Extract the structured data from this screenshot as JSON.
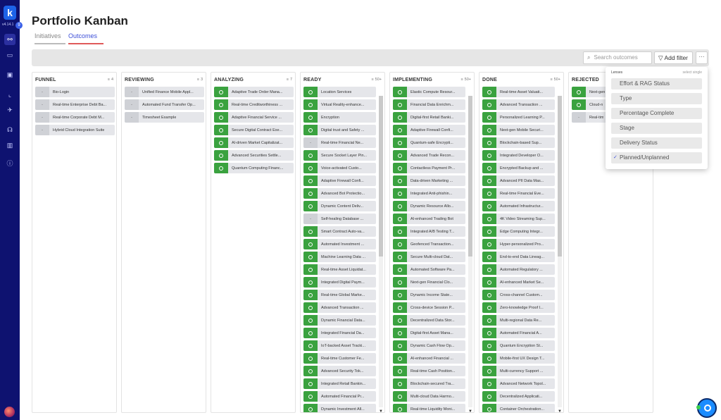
{
  "app": {
    "version": "v4.14.1",
    "notifications": "9",
    "title": "Portfolio Kanban"
  },
  "tabs": [
    {
      "label": "Initiatives",
      "active": false
    },
    {
      "label": "Outcomes",
      "active": true
    }
  ],
  "toolbar": {
    "search_placeholder": "Search outcomes",
    "add_filter_label": "Add filter",
    "more_label": "···"
  },
  "columns": [
    {
      "name": "FUNNEL",
      "count": "4",
      "cards": [
        {
          "status": "none",
          "title": "Bio-Login"
        },
        {
          "status": "none",
          "title": "Real-time Enterprise Debt Ba..."
        },
        {
          "status": "none",
          "title": "Real-time Corporate Debt M..."
        },
        {
          "status": "none",
          "title": "Hybrid Cloud Integration Suite"
        }
      ]
    },
    {
      "name": "REVIEWING",
      "count": "3",
      "cards": [
        {
          "status": "none",
          "title": "Unified Finance Mobile Appl..."
        },
        {
          "status": "none",
          "title": "Automated Fund Transfer Op..."
        },
        {
          "status": "none",
          "title": "Timesheet Example"
        }
      ]
    },
    {
      "name": "ANALYZING",
      "count": "7",
      "cards": [
        {
          "status": "green",
          "title": "Adaptive Trade Order Mana..."
        },
        {
          "status": "green",
          "title": "Real-time Creditworthiness ..."
        },
        {
          "status": "green",
          "title": "Adaptive Financial Service ..."
        },
        {
          "status": "green",
          "title": "Secure Digital Contract Exe..."
        },
        {
          "status": "green",
          "title": "AI-driven Market Capitalizat..."
        },
        {
          "status": "green",
          "title": "Advanced Securities Settle..."
        },
        {
          "status": "green",
          "title": "Quantum Computing Financ..."
        }
      ]
    },
    {
      "name": "READY",
      "count": "50+",
      "scroll": true,
      "cards": [
        {
          "status": "green",
          "title": "Location Services"
        },
        {
          "status": "green",
          "title": "Virtual Reality-enhance..."
        },
        {
          "status": "green",
          "title": "Encryption"
        },
        {
          "status": "green",
          "title": "Digital trust and Safety ..."
        },
        {
          "status": "none",
          "title": "Real-time Financial Ne..."
        },
        {
          "status": "green",
          "title": "Secure Socket Layer Pin..."
        },
        {
          "status": "green",
          "title": "Voice-activated Custo..."
        },
        {
          "status": "green",
          "title": "Adaptive Firewall Confi..."
        },
        {
          "status": "green",
          "title": "Advanced Bot Protectio..."
        },
        {
          "status": "green",
          "title": "Dynamic Content Deliv..."
        },
        {
          "status": "none",
          "title": "Self-healing Database ..."
        },
        {
          "status": "green",
          "title": "Smart Contract Auto-va..."
        },
        {
          "status": "green",
          "title": "Automated Investment ..."
        },
        {
          "status": "green",
          "title": "Machine Learning Data ..."
        },
        {
          "status": "green",
          "title": "Real-time Asset Liquidat..."
        },
        {
          "status": "green",
          "title": "Integrated Digital Paym..."
        },
        {
          "status": "green",
          "title": "Real-time Global Marke..."
        },
        {
          "status": "green",
          "title": "Advanced Transaction ..."
        },
        {
          "status": "green",
          "title": "Dynamic Financial Data..."
        },
        {
          "status": "green",
          "title": "Integrated Financial Da..."
        },
        {
          "status": "green",
          "title": "IoT-backed Asset Tracki..."
        },
        {
          "status": "green",
          "title": "Real-time Customer Fe..."
        },
        {
          "status": "green",
          "title": "Advanced Security Tok..."
        },
        {
          "status": "green",
          "title": "Integrated Retail Bankin..."
        },
        {
          "status": "green",
          "title": "Automated Financial Pr..."
        },
        {
          "status": "green",
          "title": "Dynamic Investment All..."
        }
      ]
    },
    {
      "name": "IMPLEMENTING",
      "count": "50+",
      "scroll": true,
      "cards": [
        {
          "status": "green",
          "title": "Elastic Compute Resour..."
        },
        {
          "status": "green",
          "title": "Financial Data Enrichm..."
        },
        {
          "status": "green",
          "title": "Digital-first Retail Banki..."
        },
        {
          "status": "green",
          "title": "Adaptive Firewall Confi..."
        },
        {
          "status": "green",
          "title": "Quantum-safe Encrypti..."
        },
        {
          "status": "green",
          "title": "Advanced Trade Recon..."
        },
        {
          "status": "green",
          "title": "Contactless Payment Pr..."
        },
        {
          "status": "green",
          "title": "Data-driven Marketing ..."
        },
        {
          "status": "green",
          "title": "Integrated Anti-phishin..."
        },
        {
          "status": "green",
          "title": "Dynamic Resource Allo..."
        },
        {
          "status": "green",
          "title": "AI-enhanced Trading Bot"
        },
        {
          "status": "green",
          "title": "Integrated A/B Testing T..."
        },
        {
          "status": "green",
          "title": "Geofenced Transaction..."
        },
        {
          "status": "green",
          "title": "Secure Multi-cloud Dat..."
        },
        {
          "status": "green",
          "title": "Automated Software Pa..."
        },
        {
          "status": "green",
          "title": "Next-gen Financial Clo..."
        },
        {
          "status": "green",
          "title": "Dynamic Income State..."
        },
        {
          "status": "green",
          "title": "Cross-device Session P..."
        },
        {
          "status": "green",
          "title": "Decentralized Data Stor..."
        },
        {
          "status": "green",
          "title": "Digital-first Asset Mana..."
        },
        {
          "status": "green",
          "title": "Dynamic Cash Flow Op..."
        },
        {
          "status": "green",
          "title": "AI-enhanced Financial ..."
        },
        {
          "status": "green",
          "title": "Real-time Cash Position..."
        },
        {
          "status": "green",
          "title": "Blockchain-secured Tra..."
        },
        {
          "status": "green",
          "title": "Multi-cloud Data Harmo..."
        },
        {
          "status": "green",
          "title": "Real-time Liquidity Moni..."
        }
      ]
    },
    {
      "name": "DONE",
      "count": "50+",
      "scroll": true,
      "cards": [
        {
          "status": "green",
          "title": "Real-time Asset Valuati..."
        },
        {
          "status": "green",
          "title": "Advanced Transaction ..."
        },
        {
          "status": "green",
          "title": "Personalized Learning P..."
        },
        {
          "status": "green",
          "title": "Next-gen Mobile Securi..."
        },
        {
          "status": "green",
          "title": "Blockchain-based Sup..."
        },
        {
          "status": "green",
          "title": "Integrated Developer O..."
        },
        {
          "status": "green",
          "title": "Encrypted Backup and ..."
        },
        {
          "status": "green",
          "title": "Advanced PII Data Mas..."
        },
        {
          "status": "green",
          "title": "Real-time Financial Eve..."
        },
        {
          "status": "green",
          "title": "Automated Infrastructur..."
        },
        {
          "status": "green",
          "title": "4K Video Streaming Sup..."
        },
        {
          "status": "green",
          "title": "Edge Computing Integr..."
        },
        {
          "status": "green",
          "title": "Hyper-personalized Pro..."
        },
        {
          "status": "green",
          "title": "End-to-end Data Lineag..."
        },
        {
          "status": "green",
          "title": "Automated Regulatory ..."
        },
        {
          "status": "green",
          "title": "AI-enhanced Market Se..."
        },
        {
          "status": "green",
          "title": "Cross-channel Custom..."
        },
        {
          "status": "green",
          "title": "Zero-knowledge Proof I..."
        },
        {
          "status": "green",
          "title": "Multi-regional Data Re..."
        },
        {
          "status": "green",
          "title": "Automated Financial A..."
        },
        {
          "status": "green",
          "title": "Quantum Encryption St..."
        },
        {
          "status": "green",
          "title": "Mobile-first UX Design T..."
        },
        {
          "status": "green",
          "title": "Multi-currency Support ..."
        },
        {
          "status": "green",
          "title": "Advanced Network Topol..."
        },
        {
          "status": "green",
          "title": "Decentralized Applicati..."
        },
        {
          "status": "green",
          "title": "Container Orchestration..."
        }
      ]
    },
    {
      "name": "REJECTED",
      "count": "",
      "cards": [
        {
          "status": "green",
          "title": "Next-gen"
        },
        {
          "status": "green",
          "title": "Cloud-n"
        },
        {
          "status": "none",
          "title": "Real-tim"
        }
      ]
    }
  ],
  "lenses": {
    "header": "Lenses",
    "select_hint": "select single",
    "options": [
      {
        "label": "Effort & RAG Status",
        "checked": false
      },
      {
        "label": "Type",
        "checked": false
      },
      {
        "label": "Percentage Complete",
        "checked": false
      },
      {
        "label": "Stage",
        "checked": false
      },
      {
        "label": "Delivery Status",
        "checked": false
      },
      {
        "label": "Planned/Unplanned",
        "checked": true
      }
    ]
  },
  "colors": {
    "rail": "#0e1270",
    "accent": "#3d4fd8",
    "status_green": "#3aa23f",
    "card_bg": "#e5e6ea"
  },
  "icons": {
    "nav": [
      "graph-icon",
      "briefcase-icon",
      "calendar-icon",
      "chart-icon",
      "rocket-icon",
      "team-icon",
      "building-icon",
      "info-icon"
    ]
  }
}
